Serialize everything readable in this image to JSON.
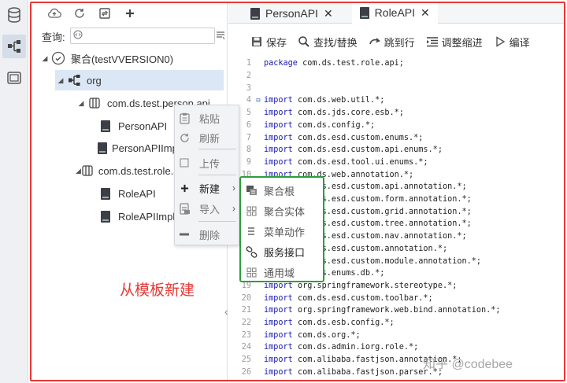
{
  "rail": {
    "items": [
      {
        "icon": "database-icon",
        "active": false
      },
      {
        "icon": "module-tree-icon",
        "active": true
      },
      {
        "icon": "window-icon",
        "active": false
      }
    ]
  },
  "tree": {
    "toolbar_icons": [
      "cloud-upload-icon",
      "refresh-icon",
      "sync-file-icon",
      "plus-icon"
    ],
    "query_label": "查询:",
    "query_placeholder": "",
    "nodes": [
      {
        "label": "聚合(testVVERSION0)",
        "icon": "project-icon"
      },
      {
        "label": "org",
        "icon": "package-tree-icon"
      },
      {
        "label": "com.ds.test.person.api",
        "icon": "module-icon"
      },
      {
        "label": "PersonAPI",
        "icon": "java-file-icon"
      },
      {
        "label": "PersonAPIImpl",
        "icon": "java-file-icon"
      },
      {
        "label": "com.ds.test.role.api",
        "icon": "module-icon"
      },
      {
        "label": "RoleAPI",
        "icon": "java-file-icon"
      },
      {
        "label": "RoleAPIImpl",
        "icon": "java-file-icon"
      }
    ]
  },
  "context_menu": {
    "items": [
      {
        "label": "粘贴",
        "icon": "paste-icon"
      },
      {
        "label": "刷新",
        "icon": "refresh-icon"
      },
      {
        "label": "上传",
        "icon": "upload-icon"
      },
      {
        "label": "新建",
        "icon": "plus-icon",
        "arrow": "›"
      },
      {
        "label": "导入",
        "icon": "import-icon",
        "arrow": "›"
      },
      {
        "label": "删除",
        "icon": "minus-icon"
      }
    ]
  },
  "submenu": {
    "items": [
      {
        "label": "聚合根",
        "icon": "aggregate-root-icon"
      },
      {
        "label": "聚合实体",
        "icon": "entity-grid-icon"
      },
      {
        "label": "菜单动作",
        "icon": "menu-lines-icon"
      },
      {
        "label": "服务接口",
        "icon": "link-icon"
      },
      {
        "label": "通用域",
        "icon": "grid-icon"
      }
    ]
  },
  "editor": {
    "tabs": [
      {
        "label": "PersonAPI",
        "close": "✕",
        "active": false
      },
      {
        "label": "RoleAPI",
        "close": "✕",
        "active": true
      }
    ],
    "toolbar": [
      {
        "label": "保存",
        "icon": "save-icon"
      },
      {
        "label": "查找/替换",
        "icon": "search-replace-icon"
      },
      {
        "label": "跳到行",
        "icon": "jump-line-icon"
      },
      {
        "label": "调整缩进",
        "icon": "indent-icon"
      },
      {
        "label": "编译",
        "icon": "play-icon"
      }
    ],
    "fold_marker": "⊟",
    "lines": [
      "package com.ds.test.role.api;",
      "",
      "",
      "import com.ds.web.util.*;",
      "import com.ds.jds.core.esb.*;",
      "import com.ds.config.*;",
      "import com.ds.esd.custom.enums.*;",
      "import com.ds.esd.custom.api.enums.*;",
      "import com.ds.esd.tool.ui.enums.*;",
      "import com.ds.web.annotation.*;",
      "import com.ds.esd.custom.api.annotation.*;",
      "import com.ds.esd.custom.form.annotation.*;",
      "import com.ds.esd.custom.grid.annotation.*;",
      "import com.ds.esd.custom.tree.annotation.*;",
      "import com.ds.esd.custom.nav.annotation.*;",
      "import com.ds.esd.custom.annotation.*;",
      "import com.ds.esd.custom.module.annotation.*;",
      "import com.ds.enums.db.*;",
      "import org.springframework.stereotype.*;",
      "import com.ds.esd.custom.toolbar.*;",
      "import org.springframework.web.bind.annotation.*;",
      "import com.ds.esb.config.*;",
      "import com.ds.org.*;",
      "import com.ds.admin.iorg.role.*;",
      "import com.alibaba.fastjson.annotation.*;",
      "import com.alibaba.fastjson.parser.*;"
    ]
  },
  "annotation": "从模板新建",
  "watermark": "知乎 @codebee",
  "colors": {
    "frame": "#e53935",
    "submenu_border": "#2e9e3b",
    "selected_row": "#dbe7f5"
  }
}
